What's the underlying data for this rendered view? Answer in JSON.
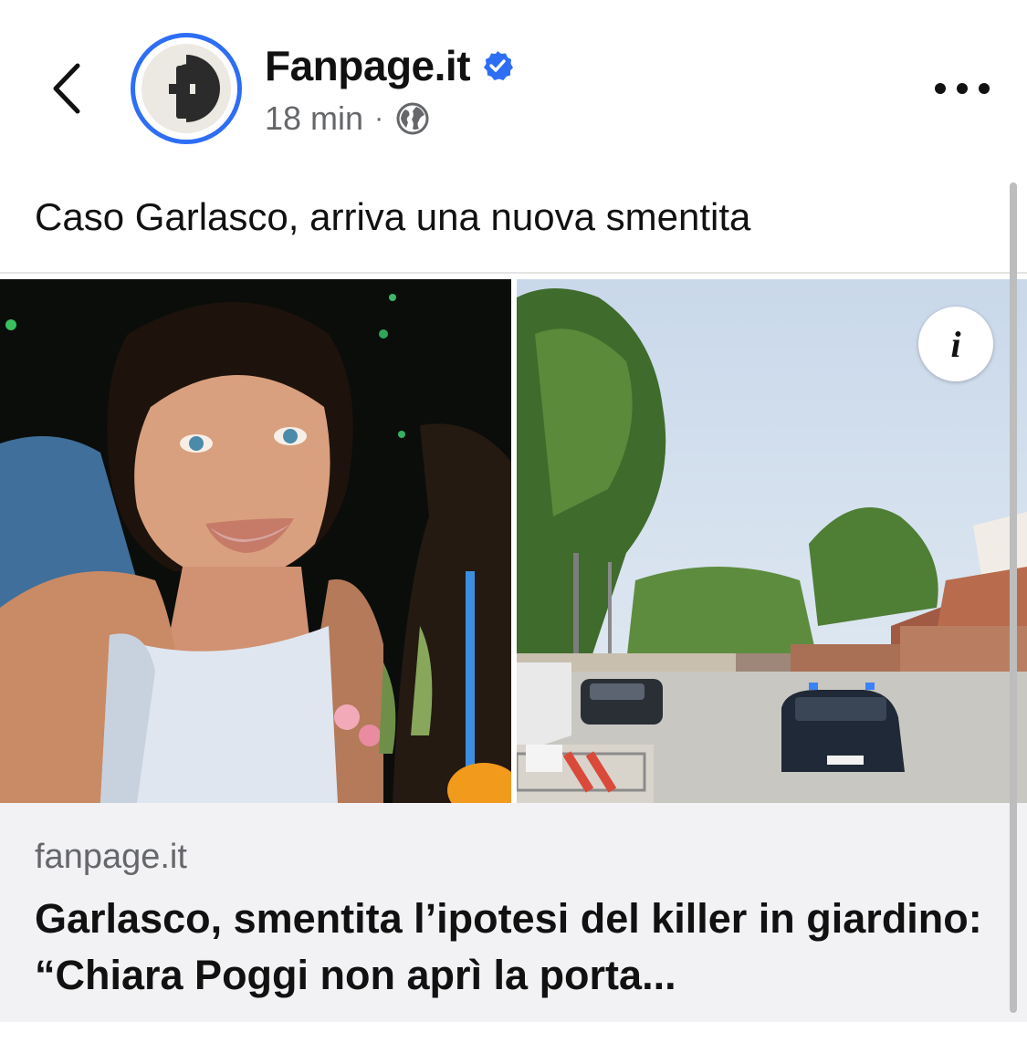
{
  "header": {
    "back_icon": "chevron-left-icon",
    "avatar_icon": "fanpage-logo",
    "page_name": "Fanpage.it",
    "verified_icon": "verified-badge-icon",
    "verified_color": "#2e6ef5",
    "timestamp": "18 min",
    "separator": "·",
    "audience_icon": "globe-icon",
    "more_icon": "more-horizontal-icon"
  },
  "post": {
    "text": "Caso Garlasco, arriva una nuova smentita"
  },
  "media": {
    "left_image": "portrait-photo",
    "right_image": "street-scene-photo",
    "info_icon": "info-icon",
    "info_glyph": "i"
  },
  "link": {
    "domain": "fanpage.it",
    "title": "Garlasco, smentita l’ipotesi del killer in giardino: “Chiara Poggi non aprì la porta..."
  }
}
